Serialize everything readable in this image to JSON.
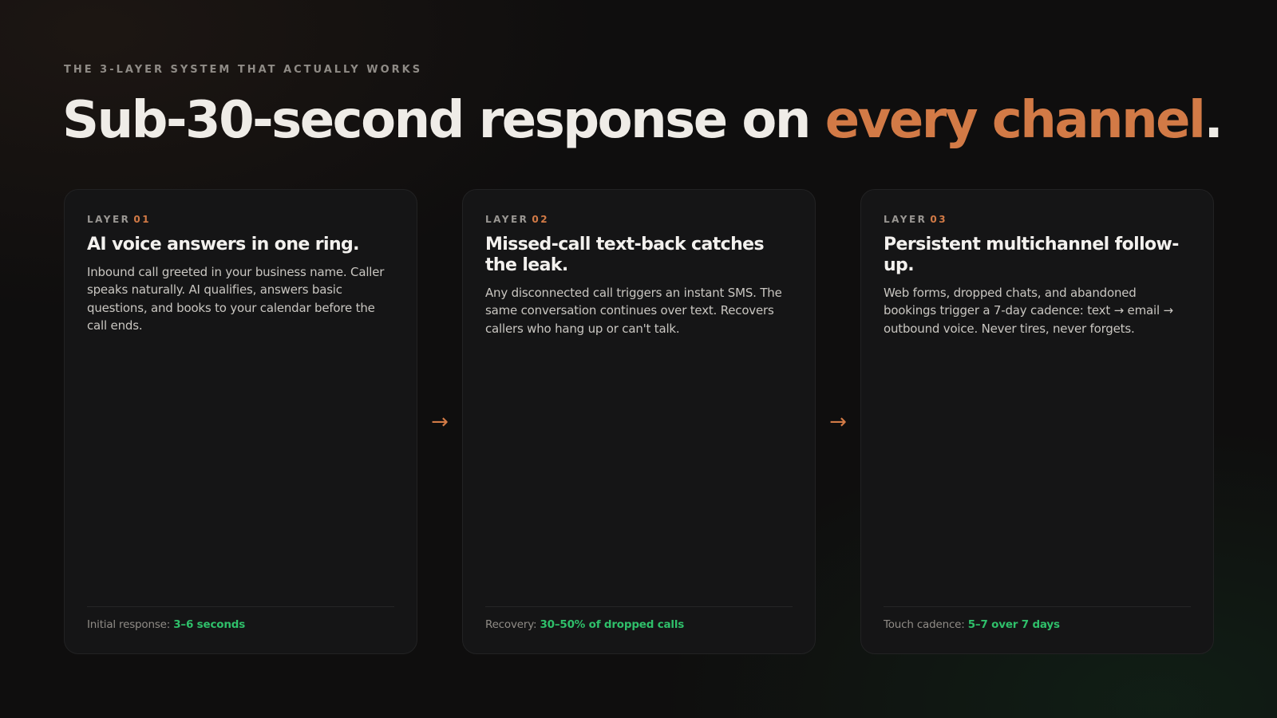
{
  "eyebrow": "THE 3-LAYER SYSTEM THAT ACTUALLY WORKS",
  "headline": {
    "main": "Sub-30-second response on ",
    "accent": "every channel",
    "end": "."
  },
  "colors": {
    "accent": "#d27a46",
    "metric": "#2fbf6a",
    "background": "#0f0e0e",
    "card": "#151516"
  },
  "arrow_icon": "→",
  "cards": [
    {
      "label": "LAYER",
      "number": "01",
      "title": "AI voice answers in one ring.",
      "body": "Inbound call greeted in your business name. Caller speaks naturally. AI qualifies, answers basic questions, and books to your calendar before the call ends.",
      "footer_label": "Initial response:",
      "footer_value": "3–6 seconds"
    },
    {
      "label": "LAYER",
      "number": "02",
      "title": "Missed-call text-back catches the leak.",
      "body": "Any disconnected call triggers an instant SMS. The same conversation continues over text. Recovers callers who hang up or can't talk.",
      "footer_label": "Recovery:",
      "footer_value": "30–50% of dropped calls"
    },
    {
      "label": "LAYER",
      "number": "03",
      "title": "Persistent multichannel follow-up.",
      "body": "Web forms, dropped chats, and abandoned bookings trigger a 7-day cadence: text → email → outbound voice. Never tires, never forgets.",
      "footer_label": "Touch cadence:",
      "footer_value": "5–7 over 7 days"
    }
  ]
}
